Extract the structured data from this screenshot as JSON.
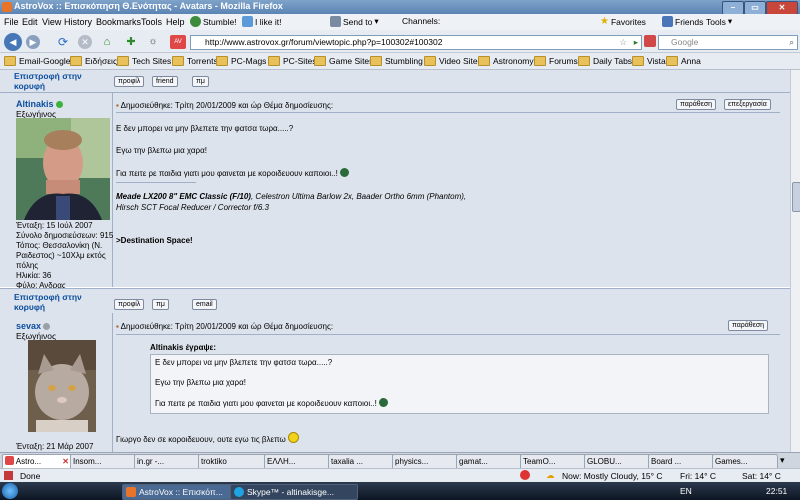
{
  "window": {
    "title": "AstroVox :: Επισκόπηση Θ.Ενότητας - Avatars - Mozilla Firefox"
  },
  "menubar": {
    "items": [
      "File",
      "Edit",
      "View",
      "History",
      "Bookmarks",
      "Tools",
      "Help"
    ],
    "toolbar": [
      "Stumble!",
      "I like it!",
      "Send to",
      "Channels:",
      "Favorites",
      "Friends",
      "Tools"
    ]
  },
  "nav": {
    "url": "http://www.astrovox.gr/forum/viewtopic.php?p=100302#100302",
    "search_placeholder": "Google"
  },
  "bookmarks": [
    "Email-Google",
    "Ειδήσεις",
    "Tech Sites",
    "Torrents",
    "PC-Mags",
    "PC-Sites",
    "Game Sites",
    "Stumbling",
    "Video Sites",
    "Astronomy",
    "Forums",
    "Daily Tabs",
    "Vista",
    "Anna"
  ],
  "forum": {
    "back_to_top": "Επιστροφή στην κορυφή",
    "btn_profile": "προφίλ",
    "btn_friend": "friend",
    "btn_pm": "πμ",
    "btn_email": "email",
    "btn_quote": "παράθεση",
    "btn_edit": "επεξεργασία",
    "post1": {
      "user": "Altinakis",
      "rank": "Εξωγήινος",
      "header": "Δημοσιεύθηκε: Τρίτη 20/01/2009 και ώρ     Θέμα δημοσίευσης:",
      "lines": [
        "Ε δεν μπορει να μην βλεπετε την φατσα τωρα.....?",
        "Εγω την βλεπω μια χαρα!",
        "Για πειτε ρε παιδια γιατι μου φαινεται με κοροιδευουν καποιοι..!"
      ],
      "sig_equipment": "Meade LX200 8\" EMC Classic (F/10)",
      "sig_rest": ", Celestron Ultima Barlow 2x, Baader Ortho 6mm (Phantom),",
      "sig_line2": "Hirsch SCT Focal Reducer / Corrector f/6.3",
      "sig_destination": ">Destination Space!",
      "info": [
        "Ένταξη: 15 Ιούλ 2007",
        "Σύνολο δημοσιεύσεων: 915",
        "Τόπος: Θεσσαλονίκη (Ν.",
        "Ραιδεστος) ~10Χλμ εκτός",
        "πόλης",
        "Ηλικία: 36",
        "Φύλο: Ανδρας"
      ]
    },
    "post2": {
      "user": "sevax",
      "rank": "Εξωγήινος",
      "header": "Δημοσιεύθηκε: Τρίτη 20/01/2009 και ώρ     Θέμα δημοσίευσης:",
      "quote_author": "Altinakis έγραψε:",
      "quote_lines": [
        "Ε δεν μπορει να μην βλεπετε την φατσα τωρα.....?",
        "Εγω την βλεπω μια χαρα!",
        "Για πειτε ρε παιδια γιατι μου φαινεται με κοροιδευουν καποιοι..!"
      ],
      "reply": "Γιωργο δεν σε κοροιδευουν, ουτε εγω τις βλεπω",
      "info_partial": "Ένταξη: 21 Μάρ 2007"
    }
  },
  "tabs": [
    "Astro...",
    "Insom...",
    "in.gr -...",
    "troktiko",
    "ΕΛΛΗ...",
    "taxalia ...",
    "physics...",
    "gamat...",
    "TeamO...",
    "GLOBU...",
    "Board ...",
    "Games..."
  ],
  "status": {
    "text": "Done",
    "weather_now": "Now: Mostly Cloudy, 15° C",
    "weather_fri": "Fri: 14° C",
    "weather_sat": "Sat: 14° C"
  },
  "taskbar": {
    "items": [
      "AstroVox :: Επισκόπ...",
      "Skype™ - altinakisge..."
    ],
    "lang": "EN",
    "clock": "22:51"
  },
  "colors": {
    "link_blue": "#0b4fa0",
    "online_green": "#3cb43c",
    "offline_gray": "#9aa0a8"
  }
}
